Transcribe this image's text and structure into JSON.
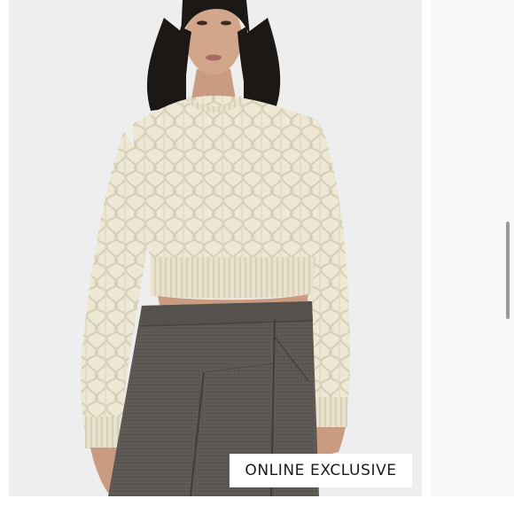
{
  "listing": {
    "badge_text": "ONLINE EXCLUSIVE",
    "photo_subject": "cream cable-knit cropped sweater with grey pleated skirt",
    "colors": {
      "sweater": "#ede7d3",
      "skirt": "#5c5955",
      "background": "#eeeeee",
      "hair": "#1c1816",
      "skin": "#c99b80"
    }
  }
}
